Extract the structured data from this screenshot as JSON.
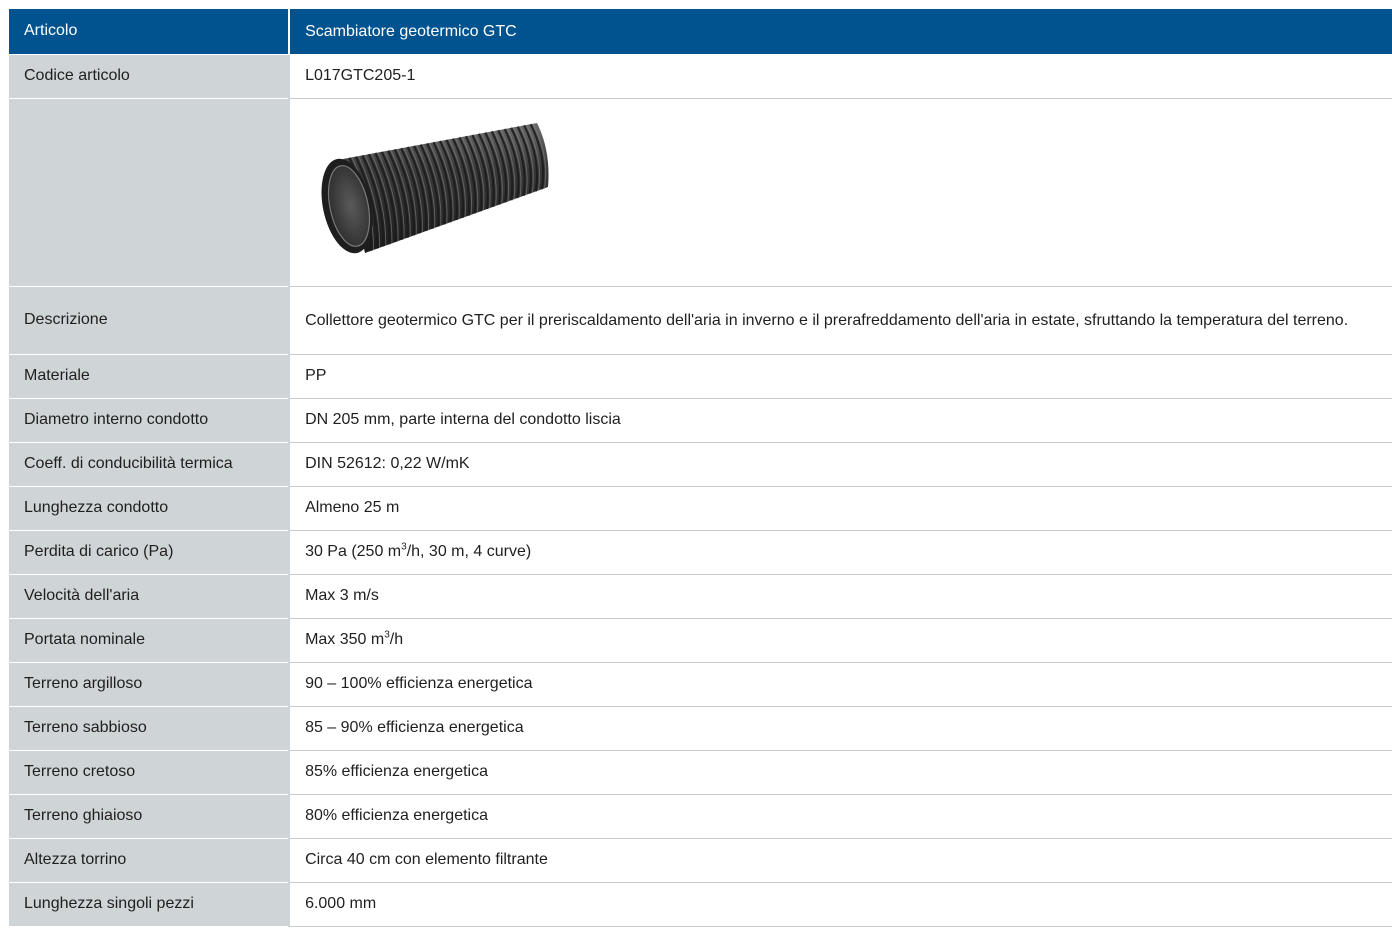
{
  "header": {
    "label": "Articolo",
    "value": "Scambiatore geotermico GTC"
  },
  "code_row": {
    "label": "Codice articolo",
    "value": "L017GTC205-1"
  },
  "image_row": {
    "label": "",
    "image": "corrugated-pipe-image"
  },
  "description_row": {
    "label": "Descrizione",
    "value": "Collettore geotermico GTC per il preriscaldamento dell'aria in inverno e il prerafreddamento dell'aria in estate, sfruttando la temperatura del terreno."
  },
  "rows": [
    {
      "label": "Materiale",
      "value": "PP"
    },
    {
      "label": "Diametro interno condotto",
      "value": "DN 205 mm, parte interna del condotto liscia"
    },
    {
      "label": "Coeff. di conducibilità termica",
      "value": "DIN 52612: 0,22 W/mK"
    },
    {
      "label": "Lunghezza condotto",
      "value": "Almeno 25 m"
    },
    {
      "label": "Perdita di carico (Pa)",
      "value_pre": "30 Pa (250 m",
      "value_sup": "3",
      "value_post": "/h, 30 m, 4 curve)"
    },
    {
      "label": "Velocità dell'aria",
      "value": "Max 3 m/s"
    },
    {
      "label": "Portata nominale",
      "value_pre": "Max 350 m",
      "value_sup": "3",
      "value_post": "/h"
    },
    {
      "label": "Terreno argilloso",
      "value": "90 – 100% efficienza energetica"
    },
    {
      "label": "Terreno sabbioso",
      "value": "85 – 90% efficienza energetica"
    },
    {
      "label": "Terreno cretoso",
      "value": "85% efficienza energetica"
    },
    {
      "label": "Terreno ghiaioso",
      "value": "80% efficienza energetica"
    },
    {
      "label": "Altezza torrino",
      "value": "Circa 40 cm con elemento filtrante"
    },
    {
      "label": "Lunghezza singoli pezzi",
      "value": "6.000 mm"
    }
  ],
  "colors": {
    "header_bg": "#00538e",
    "label_bg": "#cfd4d7",
    "value_bg": "#ffffff"
  }
}
